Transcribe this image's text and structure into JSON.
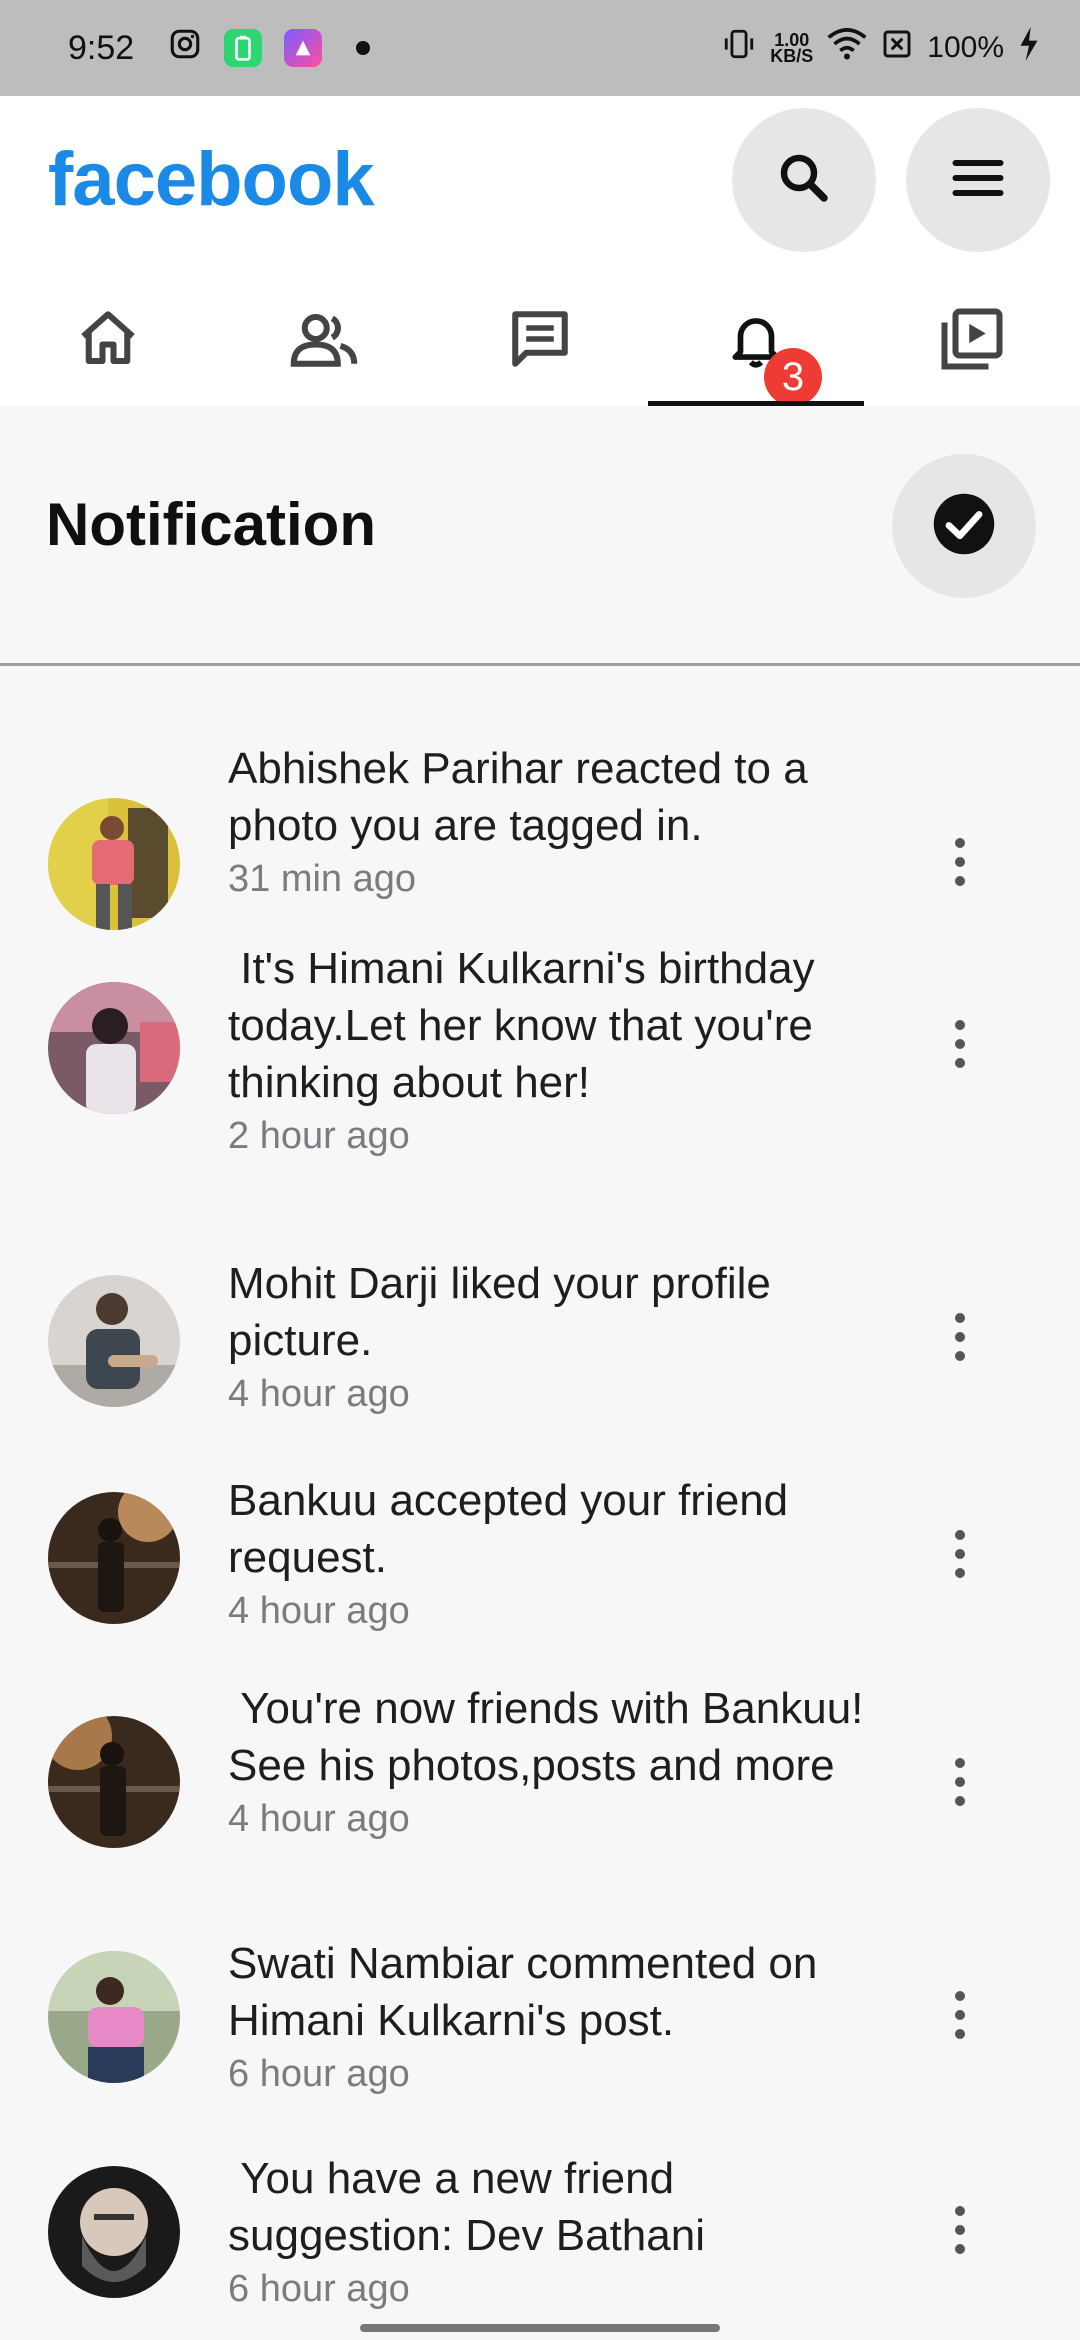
{
  "status_bar": {
    "time": "9:52",
    "net_speed_value": "1.00",
    "net_speed_unit": "KB/S",
    "battery": "100%",
    "icons": [
      "instagram-icon",
      "battery-saver-app-icon",
      "shortcut-app-icon",
      "vibrate-icon",
      "wifi-icon",
      "no-sim-icon",
      "charging-icon"
    ]
  },
  "header": {
    "logo": "facebook",
    "tabs": [
      {
        "name": "home",
        "icon": "home-icon"
      },
      {
        "name": "friends",
        "icon": "friends-icon"
      },
      {
        "name": "messages",
        "icon": "message-icon"
      },
      {
        "name": "notifications",
        "icon": "bell-icon",
        "badge": "3",
        "active": true
      },
      {
        "name": "watch",
        "icon": "video-icon"
      }
    ]
  },
  "page": {
    "title": "Notification"
  },
  "notifications": [
    {
      "message": "Abhishek Parihar reacted to a photo you are tagged in.",
      "time": "31 min ago"
    },
    {
      "message": " It's Himani Kulkarni's birthday today.Let her know that you're thinking about her!",
      "time": "2 hour ago"
    },
    {
      "message": "Mohit Darji liked your profile picture.",
      "time": "4 hour ago"
    },
    {
      "message": "Bankuu accepted your friend request.",
      "time": "4 hour ago"
    },
    {
      "message": " You're now friends with Bankuu! See his photos,posts and more",
      "time": "4 hour ago"
    },
    {
      "message": "Swati Nambiar commented on Himani Kulkarni's post.",
      "time": "6 hour ago"
    },
    {
      "message": " You have a new friend suggestion: Dev Bathani",
      "time": "6 hour ago"
    }
  ],
  "colors": {
    "brand": "#1b8ae6",
    "badge": "#ee3b33",
    "background": "#f7f7f8"
  }
}
